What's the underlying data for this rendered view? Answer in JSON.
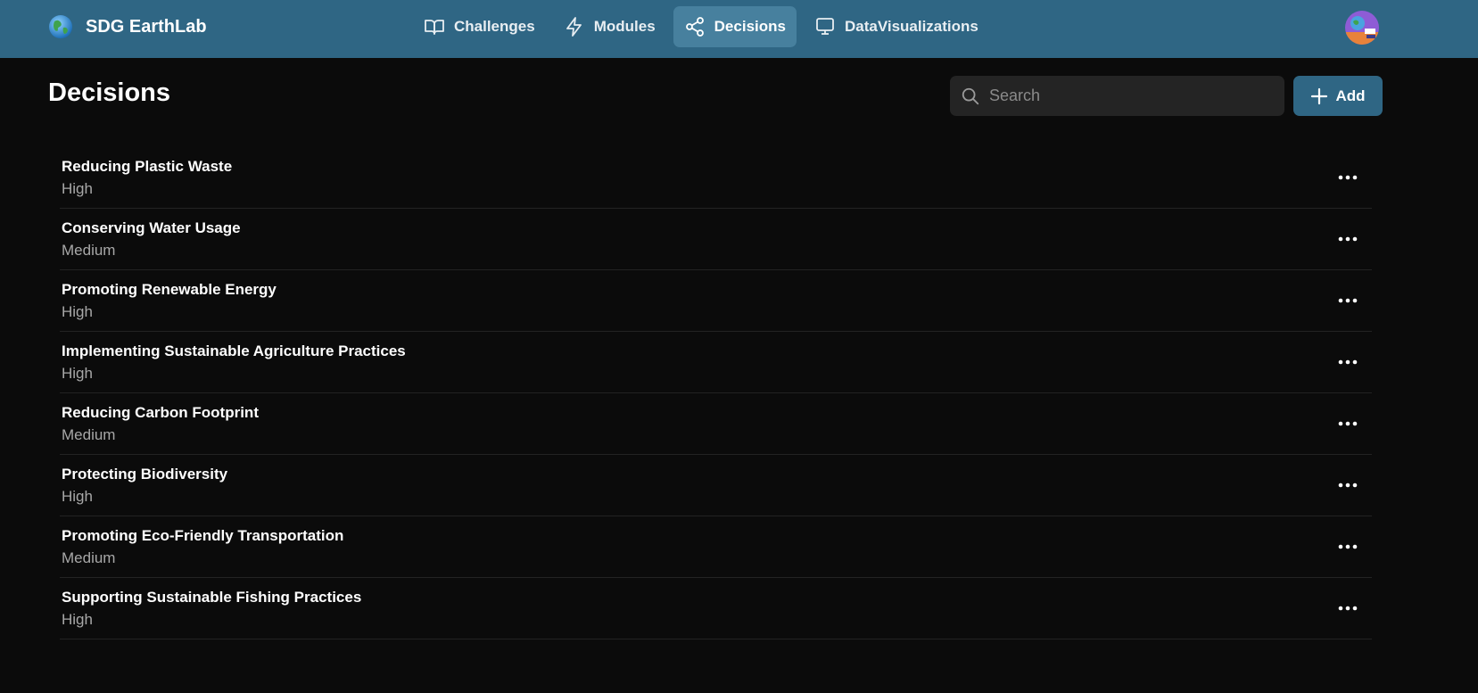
{
  "app": {
    "brand_name": "SDG EarthLab",
    "logo_icon": "globe-icon",
    "accent_color": "#2f6684"
  },
  "nav": {
    "items": [
      {
        "label": "Challenges",
        "icon": "book-open-icon",
        "active": false
      },
      {
        "label": "Modules",
        "icon": "lightning-icon",
        "active": false
      },
      {
        "label": "Decisions",
        "icon": "share-nodes-icon",
        "active": true
      },
      {
        "label": "DataVisualizations",
        "icon": "monitor-icon",
        "active": false
      }
    ]
  },
  "user": {
    "avatar_icon": "user-avatar"
  },
  "page": {
    "title": "Decisions"
  },
  "search": {
    "placeholder": "Search",
    "value": ""
  },
  "actions": {
    "add_label": "Add"
  },
  "decisions": [
    {
      "title": "Reducing Plastic Waste",
      "priority": "High"
    },
    {
      "title": "Conserving Water Usage",
      "priority": "Medium"
    },
    {
      "title": "Promoting Renewable Energy",
      "priority": "High"
    },
    {
      "title": "Implementing Sustainable Agriculture Practices",
      "priority": "High"
    },
    {
      "title": "Reducing Carbon Footprint",
      "priority": "Medium"
    },
    {
      "title": "Protecting Biodiversity",
      "priority": "High"
    },
    {
      "title": "Promoting Eco-Friendly Transportation",
      "priority": "Medium"
    },
    {
      "title": "Supporting Sustainable Fishing Practices",
      "priority": "High"
    }
  ]
}
